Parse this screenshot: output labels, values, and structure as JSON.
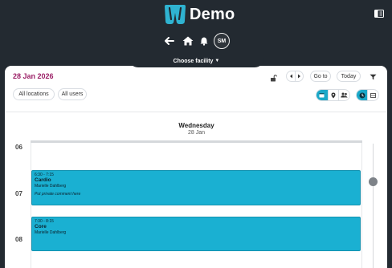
{
  "header": {
    "brand": "Demo",
    "avatar_initials": "SM",
    "facility_label": "Choose facility",
    "accent_color": "#2fb3d1"
  },
  "toolbar": {
    "date_title": "28 Jan 2026",
    "go_to_label": "Go to",
    "today_label": "Today"
  },
  "filters": {
    "locations_label": "All locations",
    "users_label": "All users"
  },
  "day": {
    "name": "Wednesday",
    "date": "28 Jan"
  },
  "hours": [
    "06",
    "07",
    "08"
  ],
  "events": [
    {
      "time": "6:30 - 7:15",
      "title": "Cardio",
      "person": "Marielle Dahlberg",
      "comment": "Put private comment here"
    },
    {
      "time": "7:30 - 8:15",
      "title": "Core",
      "person": "Marielle Dahlberg",
      "comment": ""
    }
  ],
  "colors": {
    "event_bg": "#1ab0d2",
    "date_title": "#9b1f66",
    "active_toggle": "#1aa8c8"
  }
}
